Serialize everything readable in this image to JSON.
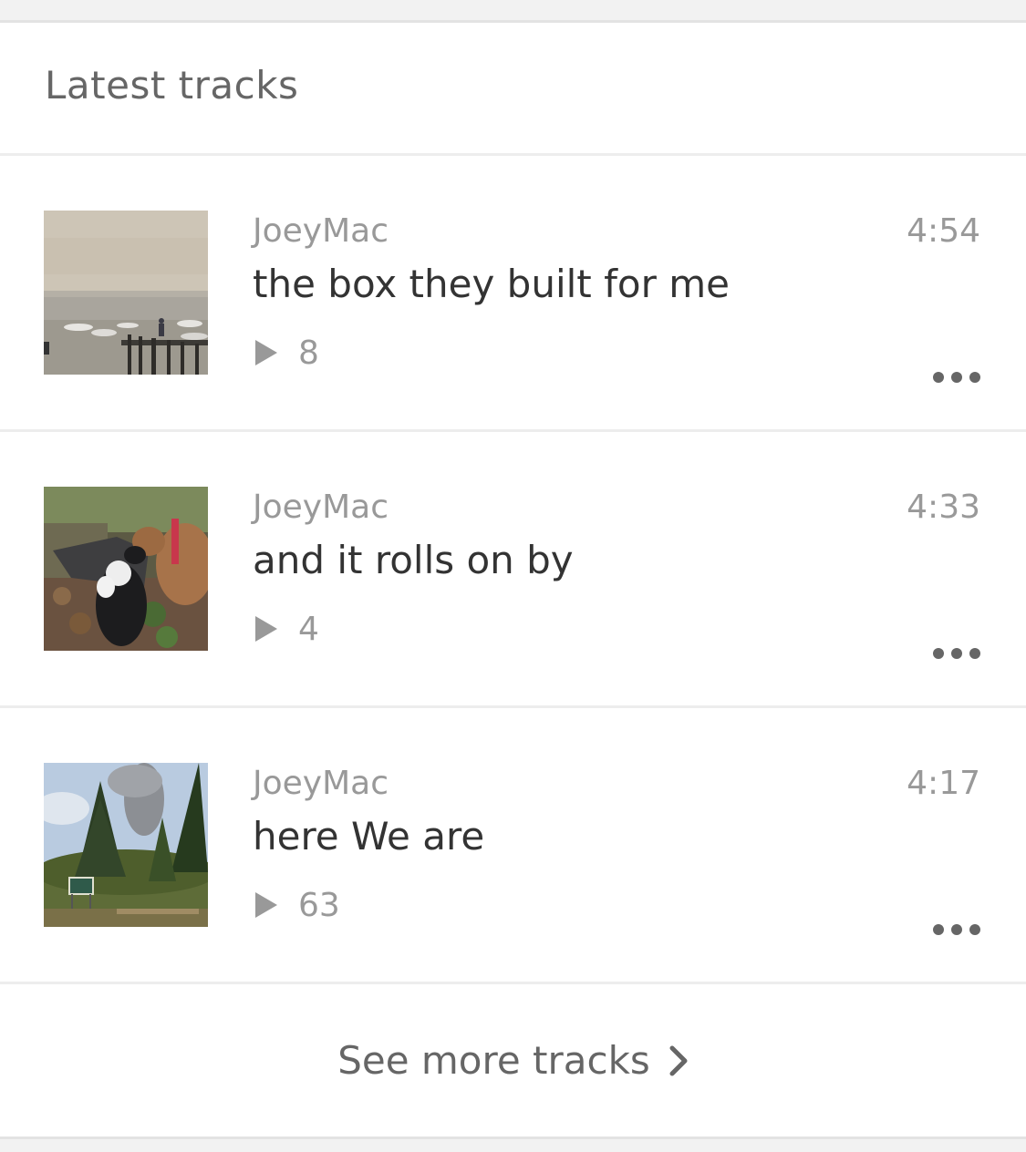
{
  "section": {
    "title": "Latest tracks"
  },
  "tracks": [
    {
      "artist": "JoeyMac",
      "title": "the box they built for me",
      "duration": "4:54",
      "plays": "8",
      "artwork": "lake-dock-boats-photo"
    },
    {
      "artist": "JoeyMac",
      "title": "and it rolls on by",
      "duration": "4:33",
      "plays": "4",
      "artwork": "dogs-in-garden-photo"
    },
    {
      "artist": "JoeyMac",
      "title": "here We are",
      "duration": "4:17",
      "plays": "63",
      "artwork": "forest-smoke-photo"
    }
  ],
  "footer": {
    "see_more_label": "See more tracks"
  },
  "icons": {
    "play": "play-icon",
    "more": "more-options-icon",
    "chevron": "chevron-right-icon"
  },
  "colors": {
    "primary_text": "#333333",
    "secondary_text": "#999999",
    "header_text": "#666666",
    "divider": "#ededed",
    "background": "#f2f2f2"
  }
}
